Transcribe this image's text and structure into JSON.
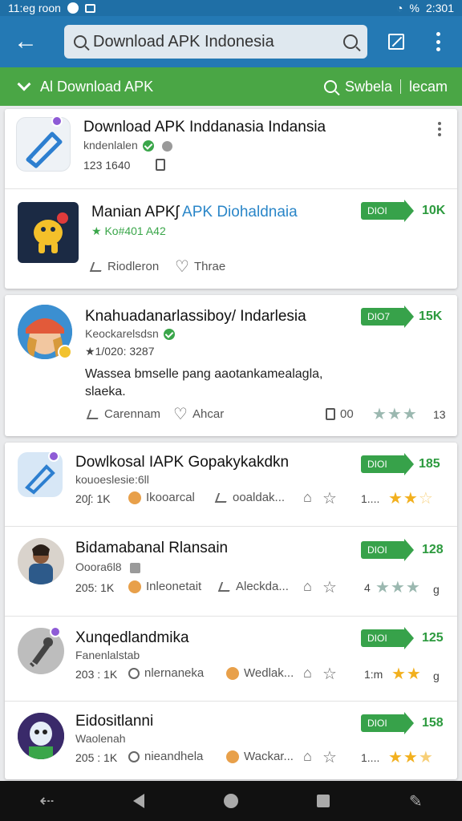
{
  "status_bar": {
    "left_text": "11:eg roon",
    "right_text": "2:301",
    "battery": "%"
  },
  "search": {
    "value": "Download APK Indonesia"
  },
  "filter_bar": {
    "title": "Al Download APK",
    "right_a": "Swbela",
    "right_b": "lecam"
  },
  "featured": {
    "title": "Download APK Inddanasia Indansia",
    "developer": "kndenlalen",
    "meta": "123 1640"
  },
  "promo": {
    "title_a": "Manian APKʃ",
    "title_b": "APK Diohaldnaia",
    "sub": "★ Ko#401 A42",
    "btn": "DIOI",
    "count": "10K",
    "action_a": "Riodleron",
    "action_b": "Thrae"
  },
  "card2": {
    "title": "Knahuadanarlassiboy/ Indarlesia",
    "developer": "Keockarelsdsn",
    "meta": "★1/020: 3287",
    "desc": "Wassea bmselle pang aaotankamealagla, slaeka.",
    "btn": "DIO7",
    "count": "15K",
    "action_a": "Carennam",
    "action_b": "Ahcar",
    "score": "00",
    "rating_num": "13"
  },
  "list": [
    {
      "title": "Dowlkosal IAPK Gopakykakdkn",
      "dev": "kouoeslesie:6ll",
      "meta": "20ʃ: 1K",
      "extra1": "Ikooarcal",
      "extra2": "ooaldak...",
      "btn": "DIOI",
      "count": "185",
      "rating_lbl": "1....",
      "stars_on": 2,
      "stars_half": 1
    },
    {
      "title": "Bidamabanal Rlansain",
      "dev": "Ooora6l8",
      "meta": "205: 1K",
      "extra1": "Inleonetait",
      "extra2": "Aleckda...",
      "btn": "DIOI",
      "count": "128",
      "rating_lbl": "4",
      "stars_on": 0,
      "stars_half": 0
    },
    {
      "title": "Xunqedlandmika",
      "dev": "Fanenlalstab",
      "meta": "203 : 1K",
      "extra1": "nlernaneka",
      "extra2": "Wedlak...",
      "btn": "DIOI",
      "count": "125",
      "rating_lbl": "1:m",
      "stars_on": 2,
      "stars_half": 0
    },
    {
      "title": "Eidositlanni",
      "dev": "Waolenah",
      "meta": "205 : 1K",
      "extra1": "nieandhela",
      "extra2": "Wackar...",
      "btn": "DIOI",
      "count": "158",
      "rating_lbl": "1....",
      "stars_on": 2,
      "stars_half": 1
    }
  ],
  "icons": {
    "back": "arrow-left-icon",
    "search": "search-icon",
    "edit": "edit-icon",
    "more": "more-vert-icon"
  },
  "colors": {
    "toolbar": "#2479b4",
    "filter_bar": "#4aa645",
    "accent": "#37a24a",
    "star": "#f2b01e"
  }
}
